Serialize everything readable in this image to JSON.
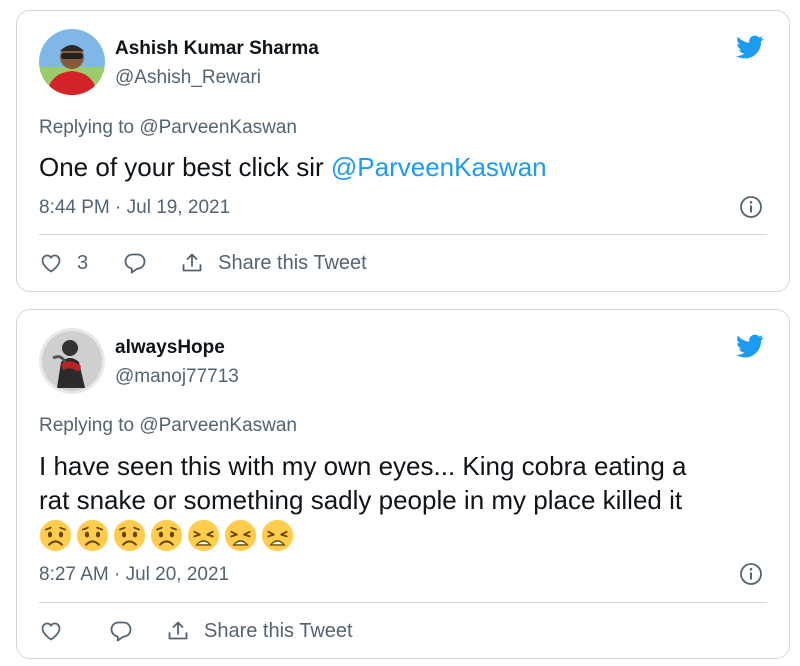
{
  "colors": {
    "accent": "#1d9bf0",
    "muted": "#536471",
    "border": "#cfd9de",
    "text": "#0f1419"
  },
  "tweets": [
    {
      "name": "Ashish Kumar Sharma",
      "handle": "@Ashish_Rewari",
      "replying_to": "Replying to @ParveenKaswan",
      "text": "One of your best click sir ",
      "mention": "@ParveenKaswan",
      "timestamp": "8:44 PM · Jul 19, 2021",
      "like_count": "3",
      "share_label": "Share this Tweet",
      "icons": [
        "twitter-bird-icon",
        "info-icon",
        "heart-icon",
        "reply-icon",
        "share-icon"
      ]
    },
    {
      "name": "alwaysHope",
      "handle": "@manoj77713",
      "replying_to": "Replying to @ParveenKaswan",
      "text_line1": "I have seen this with my own eyes... King cobra eating a",
      "text_line2": "rat snake or something sadly people in my place killed it",
      "emojis": [
        "worried",
        "worried",
        "worried",
        "worried",
        "weary",
        "weary",
        "weary"
      ],
      "timestamp": "8:27 AM · Jul 20, 2021",
      "like_count": "",
      "share_label": "Share this Tweet",
      "icons": [
        "twitter-bird-icon",
        "info-icon",
        "heart-icon",
        "reply-icon",
        "share-icon"
      ]
    }
  ]
}
